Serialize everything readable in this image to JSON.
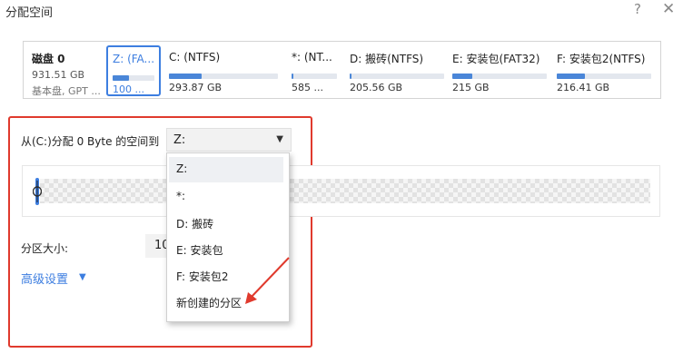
{
  "window": {
    "title": "分配空间",
    "help_glyph": "?",
    "close_glyph": "✕"
  },
  "disk_bar": {
    "disk": {
      "name": "磁盘 0",
      "capacity": "931.51 GB",
      "type": "基本盘, GPT ..."
    },
    "partitions": [
      {
        "name": "Z: (FA...",
        "size": "100 ...",
        "usage": 0.4,
        "selected": true
      },
      {
        "name": "C: (NTFS)",
        "size": "293.87 GB",
        "usage": 0.3,
        "selected": false
      },
      {
        "name": "*: (NT...",
        "size": "585 ...",
        "usage": 0.04,
        "selected": false
      },
      {
        "name": "D: 搬砖(NTFS)",
        "size": "205.56 GB",
        "usage": 0.02,
        "selected": false
      },
      {
        "name": "E: 安装包(FAT32)",
        "size": "215 GB",
        "usage": 0.21,
        "selected": false
      },
      {
        "name": "F: 安装包2(NTFS)",
        "size": "216.41 GB",
        "usage": 0.3,
        "selected": false
      }
    ]
  },
  "allocate": {
    "label": "从(C:)分配 0 Byte 的空间到",
    "target_value": "Z:",
    "dropdown_arrow": "▼"
  },
  "dropdown": {
    "options": [
      "Z:",
      "*:",
      "D: 搬砖",
      "E: 安装包",
      "F: 安装包2",
      "新创建的分区"
    ],
    "highlighted_index": 0
  },
  "partition_size": {
    "label": "分区大小:",
    "value": "10"
  },
  "advanced": {
    "label": "高级设置",
    "arrow": "▼"
  },
  "colors": {
    "accent": "#3d7ee0",
    "bar_fill": "#4a86d8",
    "annotation_red": "#e03a2d"
  }
}
